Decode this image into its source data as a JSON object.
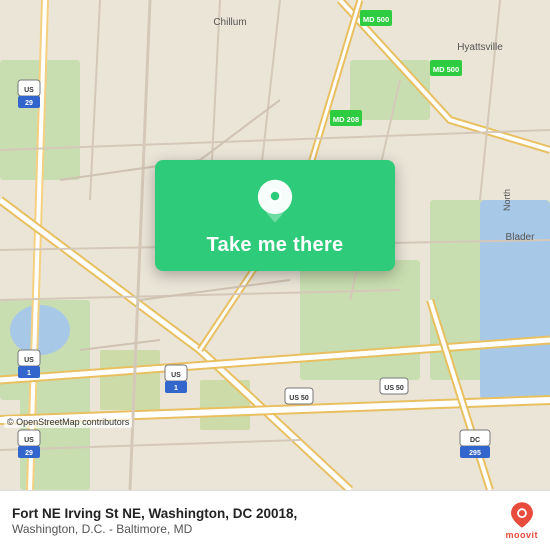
{
  "map": {
    "background_color": "#e8e0d8",
    "attribution": "© OpenStreetMap contributors"
  },
  "button": {
    "label": "Take me there",
    "background_color": "#2ecc7a"
  },
  "bottom_bar": {
    "location_title": "Fort NE Irving St NE, Washington, DC 20018,",
    "location_subtitle": "Washington, D.C. - Baltimore, MD"
  },
  "moovit": {
    "label": "moovit"
  },
  "osm": {
    "text": "© OpenStreetMap contributors"
  }
}
